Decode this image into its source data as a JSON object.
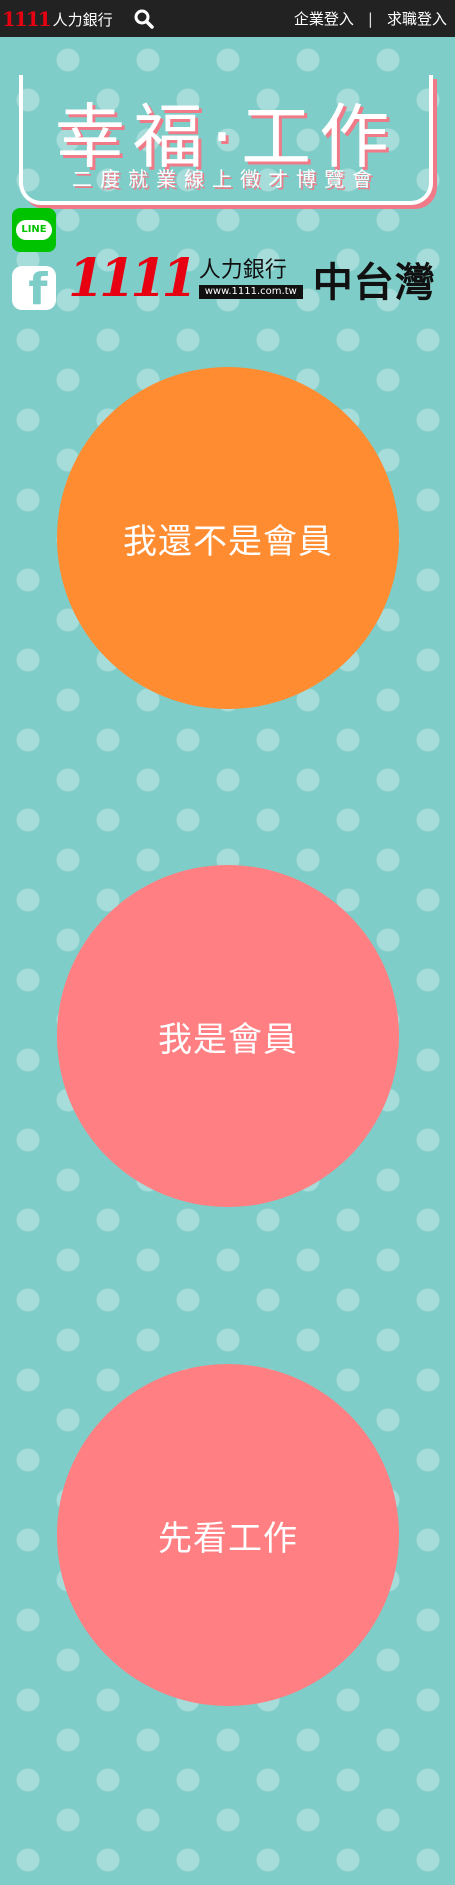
{
  "topbar": {
    "brand_logo": "1111",
    "brand_name": "人力銀行",
    "search_icon": "search-icon",
    "employer_login": "企業登入",
    "separator": "|",
    "jobseeker_login": "求職登入"
  },
  "hero": {
    "title": "幸福·工作",
    "subtitle": "二度就業線上徵才博覽會"
  },
  "social": {
    "line_label": "LINE",
    "facebook_label": "f"
  },
  "partner": {
    "logo": "1111",
    "name": "人力銀行",
    "url": "www.1111.com.tw",
    "region": "中台灣"
  },
  "actions": {
    "not_member": "我還不是會員",
    "member": "我是會員",
    "browse_jobs": "先看工作"
  },
  "colors": {
    "background": "#7fcdc9",
    "orange": "#ff8c31",
    "pink": "#ff7f82",
    "topbar": "#222222",
    "line_green": "#00c300",
    "brand_red": "#e60012"
  }
}
